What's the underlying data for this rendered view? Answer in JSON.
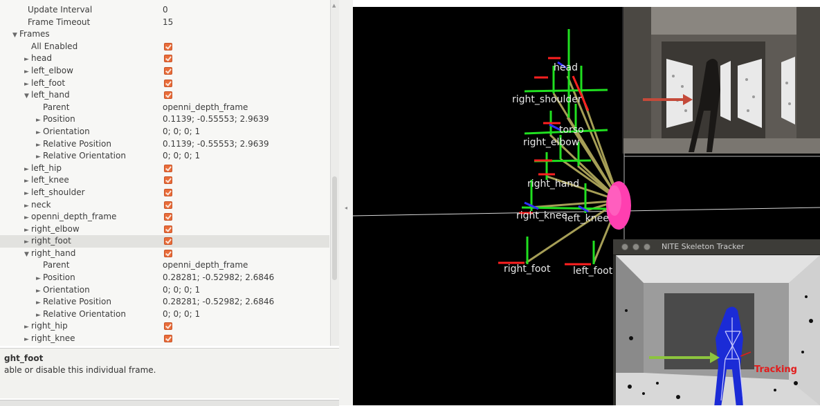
{
  "properties": {
    "rows": [
      {
        "indent": 0,
        "arrow": "",
        "name": "Update Interval",
        "value": "0"
      },
      {
        "indent": 0,
        "arrow": "",
        "name": "Frame Timeout",
        "value": "15"
      },
      {
        "indent": 0,
        "arrow": "▼",
        "name": "Frames",
        "value": ""
      },
      {
        "indent": 1,
        "arrow": "",
        "name": "All Enabled",
        "check": true
      },
      {
        "indent": 1,
        "arrow": "►",
        "name": "head",
        "check": true
      },
      {
        "indent": 1,
        "arrow": "►",
        "name": "left_elbow",
        "check": true
      },
      {
        "indent": 1,
        "arrow": "►",
        "name": "left_foot",
        "check": true
      },
      {
        "indent": 1,
        "arrow": "▼",
        "name": "left_hand",
        "check": true
      },
      {
        "indent": 2,
        "arrow": "",
        "name": "Parent",
        "value": "openni_depth_frame"
      },
      {
        "indent": 2,
        "arrow": "►",
        "name": "Position",
        "value": "0.1139; -0.55553; 2.9639"
      },
      {
        "indent": 2,
        "arrow": "►",
        "name": "Orientation",
        "value": "0; 0; 0; 1"
      },
      {
        "indent": 2,
        "arrow": "►",
        "name": "Relative Position",
        "value": "0.1139; -0.55553; 2.9639"
      },
      {
        "indent": 2,
        "arrow": "►",
        "name": "Relative Orientation",
        "value": "0; 0; 0; 1"
      },
      {
        "indent": 1,
        "arrow": "►",
        "name": "left_hip",
        "check": true
      },
      {
        "indent": 1,
        "arrow": "►",
        "name": "left_knee",
        "check": true
      },
      {
        "indent": 1,
        "arrow": "►",
        "name": "left_shoulder",
        "check": true
      },
      {
        "indent": 1,
        "arrow": "►",
        "name": "neck",
        "check": true
      },
      {
        "indent": 1,
        "arrow": "►",
        "name": "openni_depth_frame",
        "check": true
      },
      {
        "indent": 1,
        "arrow": "►",
        "name": "right_elbow",
        "check": true
      },
      {
        "indent": 1,
        "arrow": "►",
        "name": "right_foot",
        "check": true,
        "selected": true
      },
      {
        "indent": 1,
        "arrow": "▼",
        "name": "right_hand",
        "check": true
      },
      {
        "indent": 2,
        "arrow": "",
        "name": "Parent",
        "value": "openni_depth_frame"
      },
      {
        "indent": 2,
        "arrow": "►",
        "name": "Position",
        "value": "0.28281; -0.52982; 2.6846"
      },
      {
        "indent": 2,
        "arrow": "►",
        "name": "Orientation",
        "value": "0; 0; 0; 1"
      },
      {
        "indent": 2,
        "arrow": "►",
        "name": "Relative Position",
        "value": "0.28281; -0.52982; 2.6846"
      },
      {
        "indent": 2,
        "arrow": "►",
        "name": "Relative Orientation",
        "value": "0; 0; 0; 1"
      },
      {
        "indent": 1,
        "arrow": "►",
        "name": "right_hip",
        "check": true
      },
      {
        "indent": 1,
        "arrow": "►",
        "name": "right_knee",
        "check": true
      }
    ]
  },
  "description": {
    "title": "ght_foot",
    "text": "able or disable this individual frame."
  },
  "view3d": {
    "labels": {
      "head": "head",
      "right_shoulder": "right_shoulder",
      "right_elbow": "right_elbow",
      "right_hand": "right_hand",
      "torso": "torso",
      "right_knee": "right_knee",
      "left_knee": "left_knee",
      "right_foot": "right_foot",
      "left_foot": "left_foot"
    }
  },
  "tracker": {
    "title": "NITE Skeleton Tracker",
    "status": "Tracking"
  },
  "colors": {
    "checkbox": "#e96d3a",
    "frame_axis_x": "#ff2020",
    "frame_axis_y": "#20e020",
    "frame_axis_z": "#3030ff",
    "tf_link": "#b8b060",
    "cursor_marker": "#ff3fb0",
    "arrow_red": "#c44a3a",
    "arrow_green": "#8cc43e",
    "tracking_text": "#e21c1c"
  }
}
